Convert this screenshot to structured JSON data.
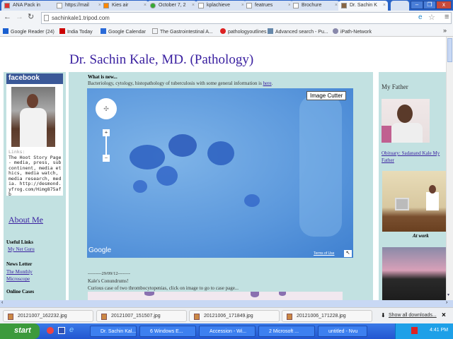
{
  "browser": {
    "tabs": [
      {
        "label": "ANA Pack in",
        "icon": "gmail-icon"
      },
      {
        "label": "https://mail",
        "icon": "page-icon"
      },
      {
        "label": "Kies air",
        "icon": "kies-icon"
      },
      {
        "label": "October 7, 2",
        "icon": "google-doodle-icon"
      },
      {
        "label": "kplachieve",
        "icon": "page-icon"
      },
      {
        "label": "featrues",
        "icon": "page-icon"
      },
      {
        "label": "Brochure",
        "icon": "page-icon"
      },
      {
        "label": "Dr. Sachin K",
        "icon": "avatar-icon"
      }
    ],
    "url": "sachinkale1.tripod.com",
    "bookmarks": [
      {
        "label": "Google Reader (24)",
        "color": "#1a5fd0"
      },
      {
        "label": "India Today",
        "color": "#c00"
      },
      {
        "label": "Google Calendar",
        "color": "#2a6ad8"
      },
      {
        "label": "The Gastrointestinal A...",
        "color": "#fff"
      },
      {
        "label": "pathologyoutlines",
        "color": "#d22"
      },
      {
        "label": "Advanced search - Pu...",
        "color": "#68a"
      },
      {
        "label": "iPath-Network",
        "color": "#88a"
      }
    ]
  },
  "page": {
    "title": "Dr. Sachin Kale, MD. (Pathology)",
    "left": {
      "facebook_label": "facebook",
      "fb_links_label": "Links:",
      "fb_links_text": "The Hoot Story Page - media, press, subcontinent, media ethics, media watch, media research, media. http://desmond.yfrog.com/Himg875afb",
      "about_me": "About Me",
      "useful_links_heading": "Useful Links",
      "useful_link": "My Net Guru",
      "newsletter_heading": "News Letter",
      "newsletter_link": "The Monthly Microscope",
      "online_cases_heading": "Online Cases"
    },
    "main": {
      "whats_new": "What is new...",
      "intro_text": "Bacteriology, cytology, histopathology of tuberculosis with some general information is ",
      "intro_link": "here",
      "image_cutter": "Image Cutter",
      "map_logo": "Google",
      "terms": "Terms of Use",
      "date_line": "---------29/09/12--------",
      "conundrum_title": "Kale's Conundrums!",
      "conundrum_text": "Curious case of two thrombocytopenias, click on image to go to case page..."
    },
    "right": {
      "heading": "My Father",
      "obituary_link": "Obituary: Sadanand Kale My Father",
      "at_work": "At work"
    }
  },
  "downloads": {
    "items": [
      "20121007_162232.jpg",
      "20121007_151507.jpg",
      "20121006_171849.jpg",
      "20121006_171228.jpg"
    ],
    "show_all": "Show all downloads..."
  },
  "taskbar": {
    "start": "start",
    "items": [
      "Dr. Sachin Kal...",
      "6 Windows E...",
      "Accession - Wi...",
      "2 Microsoft ...",
      "untitled - Nvu"
    ],
    "clock": "4:41 PM"
  }
}
